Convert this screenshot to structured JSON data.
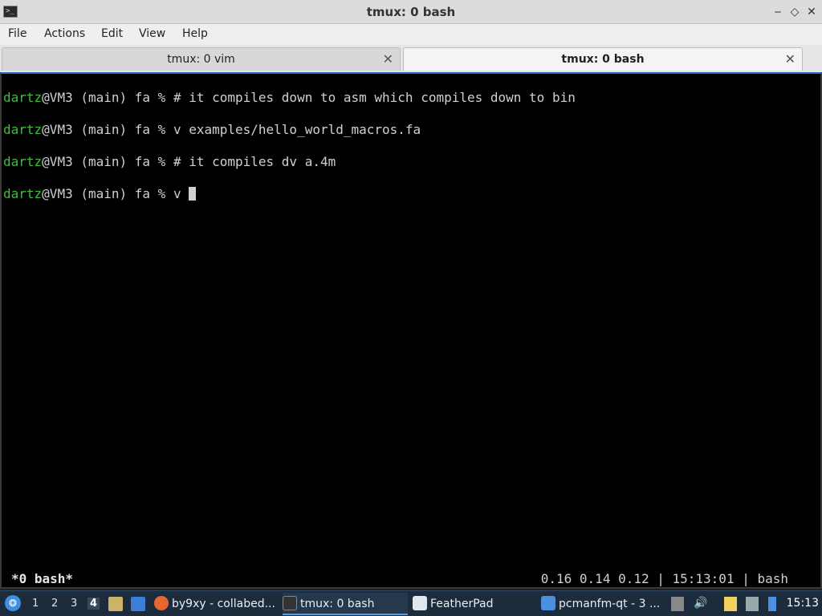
{
  "window": {
    "title": "tmux: 0 bash",
    "app_icon": "terminal-icon",
    "minimize_glyph": "‒",
    "maximize_glyph": "◇",
    "close_glyph": "✕"
  },
  "menu": {
    "items": [
      "File",
      "Actions",
      "Edit",
      "View",
      "Help"
    ]
  },
  "tabs": [
    {
      "label": "tmux: 0 vim",
      "close": "✕",
      "active": false
    },
    {
      "label": "tmux: 0 bash",
      "close": "✕",
      "active": true
    }
  ],
  "terminal": {
    "lines": [
      {
        "user": "dartz",
        "host": "@VM3 (main) fa % ",
        "cmd": "# it compiles down to asm which compiles down to bin"
      },
      {
        "user": "dartz",
        "host": "@VM3 (main) fa % ",
        "cmd": "v examples/hello_world_macros.fa"
      },
      {
        "user": "dartz",
        "host": "@VM3 (main) fa % ",
        "cmd": "# it compiles dv a.4m"
      },
      {
        "user": "dartz",
        "host": "@VM3 (main) fa % ",
        "cmd": "v "
      }
    ],
    "status_left": "*0 bash*",
    "status_right": "0.16 0.14 0.12 | 15:13:01 | bash"
  },
  "taskbar": {
    "start_icon": "start-menu-icon",
    "workspaces": [
      "1",
      "2",
      "3",
      "4"
    ],
    "current_workspace": "4",
    "tasks": [
      {
        "label": "by9xy - collabed...",
        "icon": "firefox-icon"
      },
      {
        "label": "tmux: 0 bash",
        "icon": "terminal-icon"
      },
      {
        "label": "FeatherPad",
        "icon": "featherpad-icon"
      },
      {
        "label": "pcmanfm-qt - 3 ...",
        "icon": "folder-icon"
      }
    ],
    "clock": "15:13"
  },
  "colors": {
    "prompt_user": "#3fbf3f",
    "terminal_bg": "#000000",
    "taskbar_bg": "#1d2c3d",
    "accent": "#2a6cbf"
  }
}
